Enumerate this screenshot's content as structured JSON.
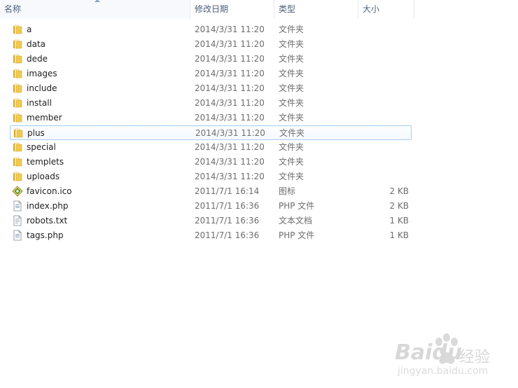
{
  "columns": {
    "name": "名称",
    "date": "修改日期",
    "type": "类型",
    "size": "大小"
  },
  "files": [
    {
      "name": "a",
      "date": "2014/3/31 11:20",
      "type": "文件夹",
      "size": "",
      "icon": "folder-icon"
    },
    {
      "name": "data",
      "date": "2014/3/31 11:20",
      "type": "文件夹",
      "size": "",
      "icon": "folder-icon"
    },
    {
      "name": "dede",
      "date": "2014/3/31 11:20",
      "type": "文件夹",
      "size": "",
      "icon": "folder-icon"
    },
    {
      "name": "images",
      "date": "2014/3/31 11:20",
      "type": "文件夹",
      "size": "",
      "icon": "folder-icon"
    },
    {
      "name": "include",
      "date": "2014/3/31 11:20",
      "type": "文件夹",
      "size": "",
      "icon": "folder-icon"
    },
    {
      "name": "install",
      "date": "2014/3/31 11:20",
      "type": "文件夹",
      "size": "",
      "icon": "folder-icon"
    },
    {
      "name": "member",
      "date": "2014/3/31 11:20",
      "type": "文件夹",
      "size": "",
      "icon": "folder-icon"
    },
    {
      "name": "plus",
      "date": "2014/3/31 11:20",
      "type": "文件夹",
      "size": "",
      "icon": "folder-icon",
      "selected": true
    },
    {
      "name": "special",
      "date": "2014/3/31 11:20",
      "type": "文件夹",
      "size": "",
      "icon": "folder-icon"
    },
    {
      "name": "templets",
      "date": "2014/3/31 11:20",
      "type": "文件夹",
      "size": "",
      "icon": "folder-icon"
    },
    {
      "name": "uploads",
      "date": "2014/3/31 11:20",
      "type": "文件夹",
      "size": "",
      "icon": "folder-icon"
    },
    {
      "name": "favicon.ico",
      "date": "2011/7/1 16:14",
      "type": "图标",
      "size": "2 KB",
      "icon": "favicon-icon"
    },
    {
      "name": "index.php",
      "date": "2011/7/1 16:36",
      "type": "PHP 文件",
      "size": "2 KB",
      "icon": "document-icon"
    },
    {
      "name": "robots.txt",
      "date": "2011/7/1 16:36",
      "type": "文本文档",
      "size": "1 KB",
      "icon": "text-document-icon"
    },
    {
      "name": "tags.php",
      "date": "2011/7/1 16:36",
      "type": "PHP 文件",
      "size": "1 KB",
      "icon": "document-icon"
    }
  ],
  "watermark": {
    "brand": "Baidu",
    "brand_suffix": "经验",
    "url": "jingyan.baidu.com"
  },
  "colors": {
    "folder": "#f2c94c",
    "selected_border": "#a7cdf0",
    "header_text": "#4c607a"
  }
}
